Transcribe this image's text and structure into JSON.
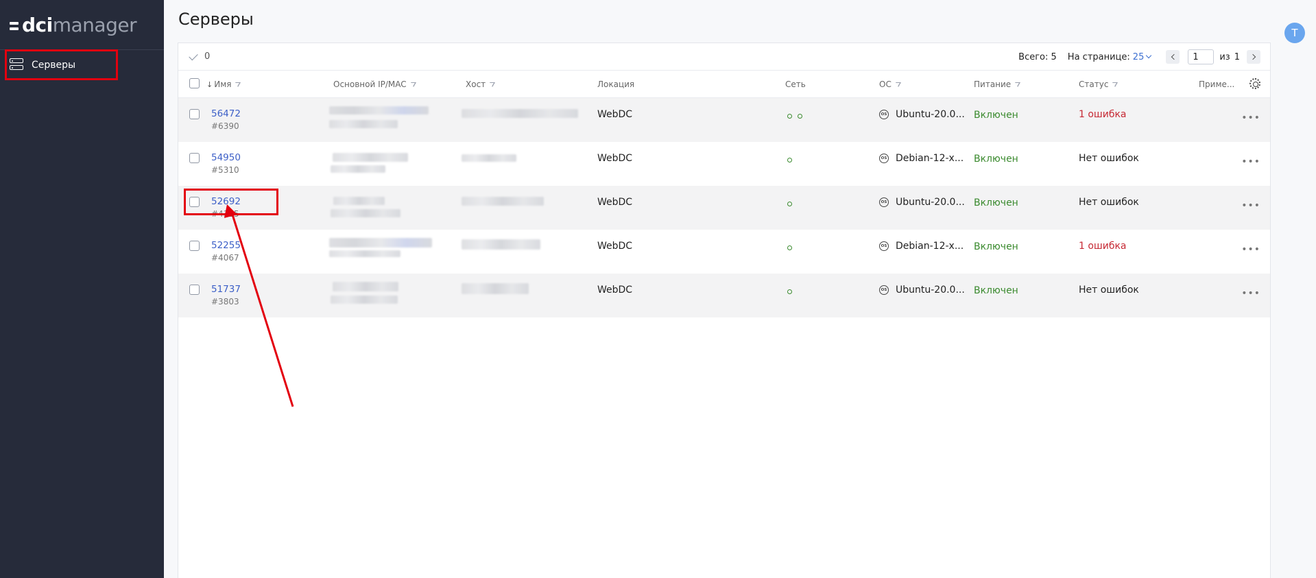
{
  "app": {
    "logo_primary": "dci",
    "logo_secondary": "manager"
  },
  "sidebar": {
    "items": [
      {
        "label": "Серверы",
        "icon": "server-icon",
        "active": true
      }
    ]
  },
  "header": {
    "title": "Серверы",
    "avatar_letter": "Т"
  },
  "toolbar": {
    "selected_count": "0",
    "total_label": "Всего: 5",
    "per_page_label": "На странице:",
    "per_page_value": "25",
    "page_value": "1",
    "of_label": "из",
    "total_pages": "1"
  },
  "table": {
    "columns": [
      "Имя",
      "Основной IP/MAC",
      "Хост",
      "Локация",
      "Сеть",
      "ОС",
      "Питание",
      "Статус",
      "Приме..."
    ],
    "rows": [
      {
        "name": "56472",
        "id": "#6390",
        "location": "WebDC",
        "net_ports": 2,
        "os": "Ubuntu-20.0...",
        "power": "Включен",
        "status": "1 ошибка",
        "status_type": "error"
      },
      {
        "name": "54950",
        "id": "#5310",
        "location": "WebDC",
        "net_ports": 1,
        "os": "Debian-12-x...",
        "power": "Включен",
        "status": "Нет ошибок",
        "status_type": "ok"
      },
      {
        "name": "52692",
        "id": "#4325",
        "location": "WebDC",
        "net_ports": 1,
        "os": "Ubuntu-20.0...",
        "power": "Включен",
        "status": "Нет ошибок",
        "status_type": "ok"
      },
      {
        "name": "52255",
        "id": "#4067",
        "location": "WebDC",
        "net_ports": 1,
        "os": "Debian-12-x...",
        "power": "Включен",
        "status": "1 ошибка",
        "status_type": "error"
      },
      {
        "name": "51737",
        "id": "#3803",
        "location": "WebDC",
        "net_ports": 1,
        "os": "Ubuntu-20.0...",
        "power": "Включен",
        "status": "Нет ошибок",
        "status_type": "ok"
      }
    ]
  },
  "colors": {
    "sidebar_bg": "#262b3a",
    "link": "#3c5fc7",
    "power_on": "#3a8a2e",
    "error": "#c62833",
    "annotation": "#e3000f"
  }
}
